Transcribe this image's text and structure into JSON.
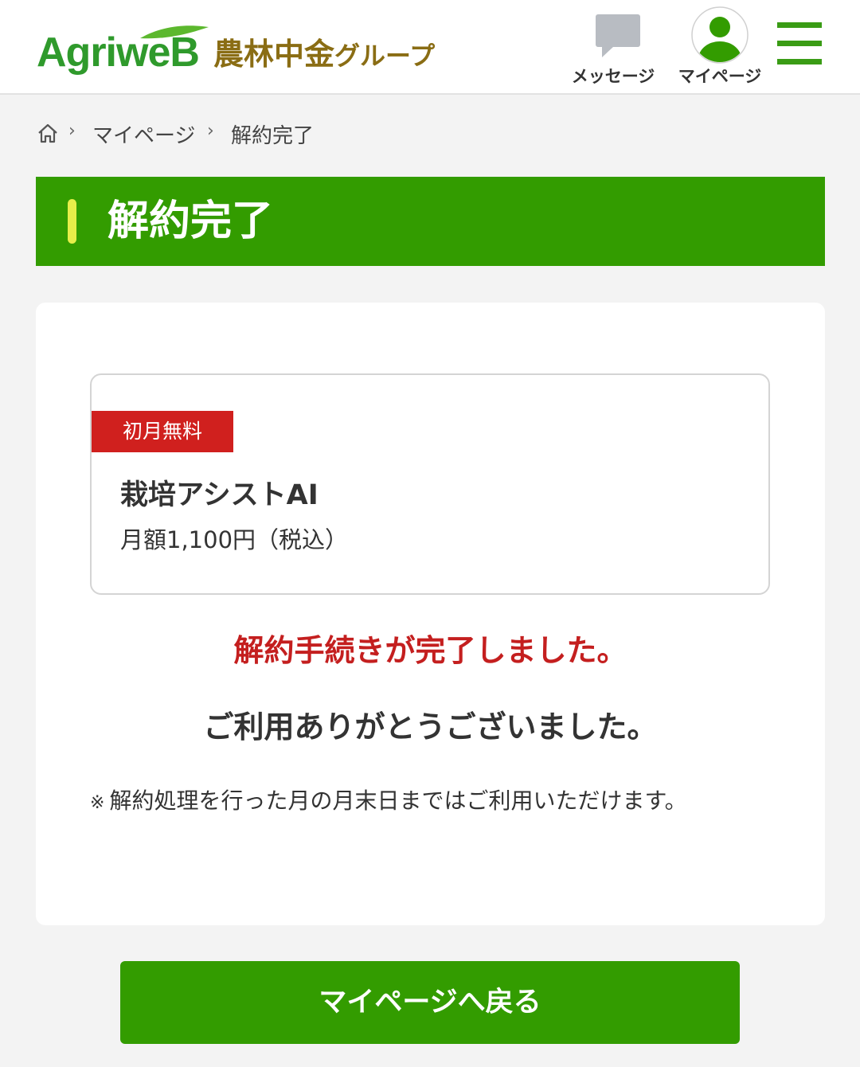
{
  "brand": {
    "logo_text": "AgriweB",
    "group_name_big": "農林中金",
    "group_name_small": "グループ"
  },
  "header": {
    "message_label": "メッセージ",
    "mypage_label": "マイページ",
    "colors": {
      "accent_green": "#339c00",
      "icon_gray": "#b8bcc2"
    }
  },
  "breadcrumb": {
    "items": [
      "マイページ",
      "解約完了"
    ]
  },
  "page": {
    "title": "解約完了"
  },
  "plan": {
    "badge": "初月無料",
    "name": "栽培アシストAI",
    "price": "月額1,100円（税込）"
  },
  "messages": {
    "completed": "解約手続きが完了しました。",
    "thanks": "ご利用ありがとうございました。",
    "note_mark": "※",
    "note": "解約処理を行った月の月末日まではご利用いただけます。"
  },
  "actions": {
    "back_to_mypage": "マイページへ戻る"
  }
}
